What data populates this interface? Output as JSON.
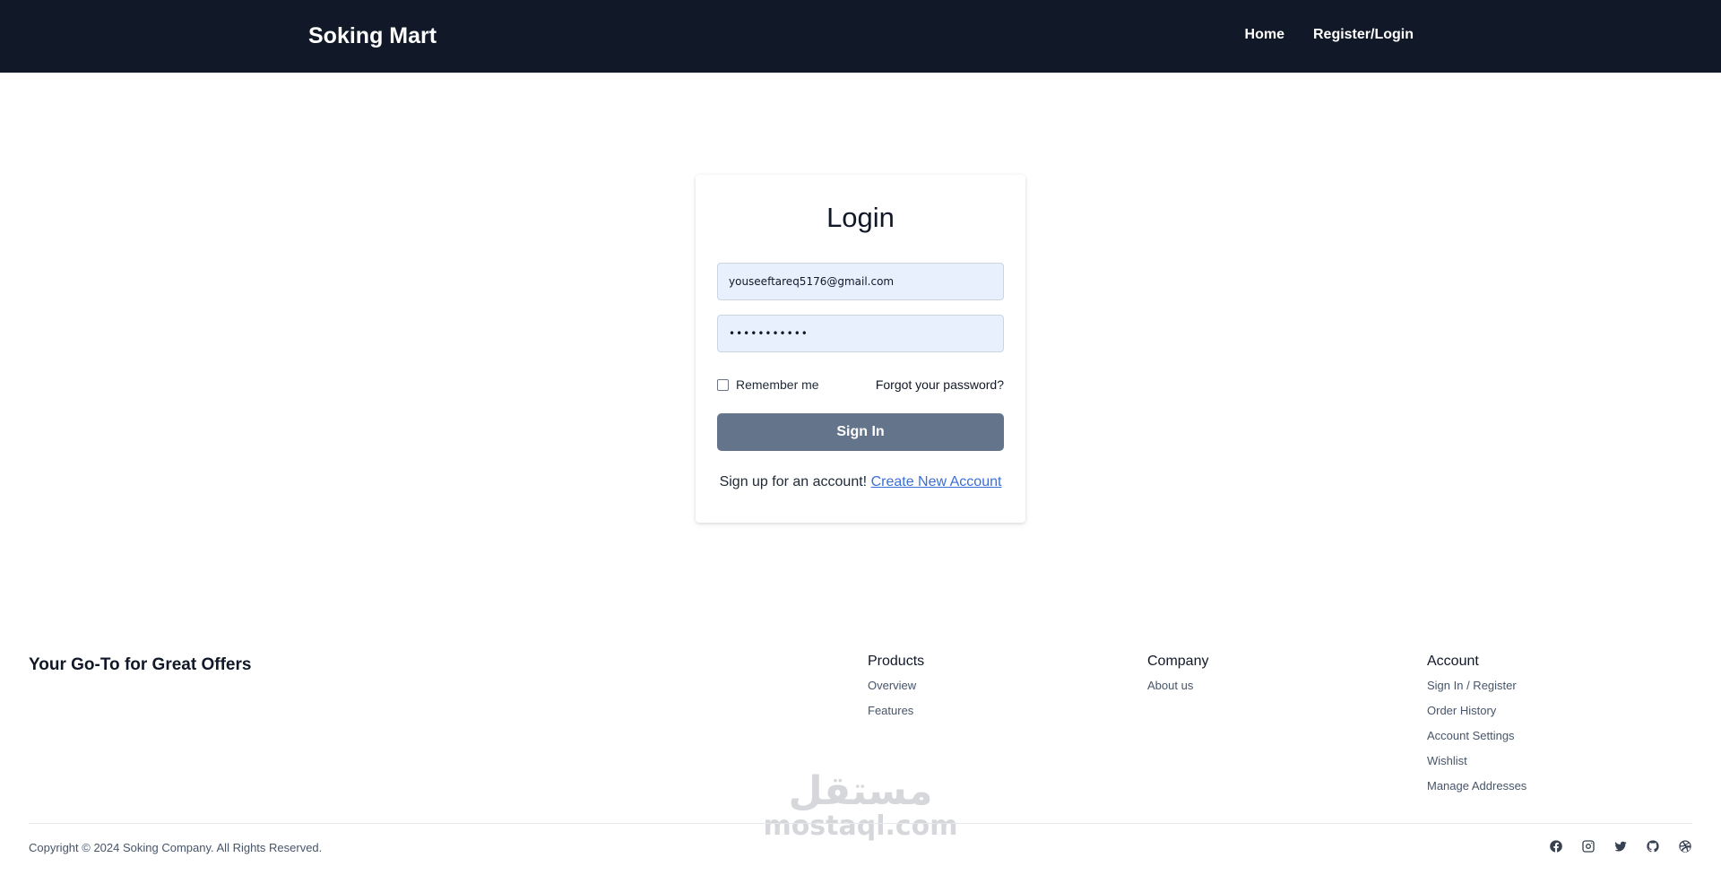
{
  "header": {
    "brand": "Soking Mart",
    "nav": [
      "Home",
      "Register/Login"
    ]
  },
  "login": {
    "title": "Login",
    "email_value": "youseeftareq5176@gmail.com",
    "password_value": "•••••••••••",
    "remember_label": "Remember me",
    "forgot_label": "Forgot your password?",
    "signin_label": "Sign In",
    "signup_text": "Sign up for an account!",
    "signup_link": "Create New Account"
  },
  "footer": {
    "tagline": "Your Go-To for Great Offers",
    "products": {
      "title": "Products",
      "links": [
        "Overview",
        "Features"
      ]
    },
    "company": {
      "title": "Company",
      "links": [
        "About us"
      ]
    },
    "account": {
      "title": "Account",
      "links": [
        "Sign In / Register",
        "Order History",
        "Account Settings",
        "Wishlist",
        "Manage Addresses"
      ]
    },
    "copyright": "Copyright © 2024 Soking Company. All Rights Reserved.",
    "social_icons": [
      "facebook-icon",
      "instagram-icon",
      "twitter-icon",
      "github-icon",
      "dribbble-icon"
    ]
  },
  "watermark": {
    "arabic": "مستقل",
    "latin": "mostaql.com"
  },
  "colors": {
    "header_bg": "#111827",
    "button_bg": "#64748b",
    "link": "#3b6fd8",
    "input_bg": "#e8f0fe"
  }
}
